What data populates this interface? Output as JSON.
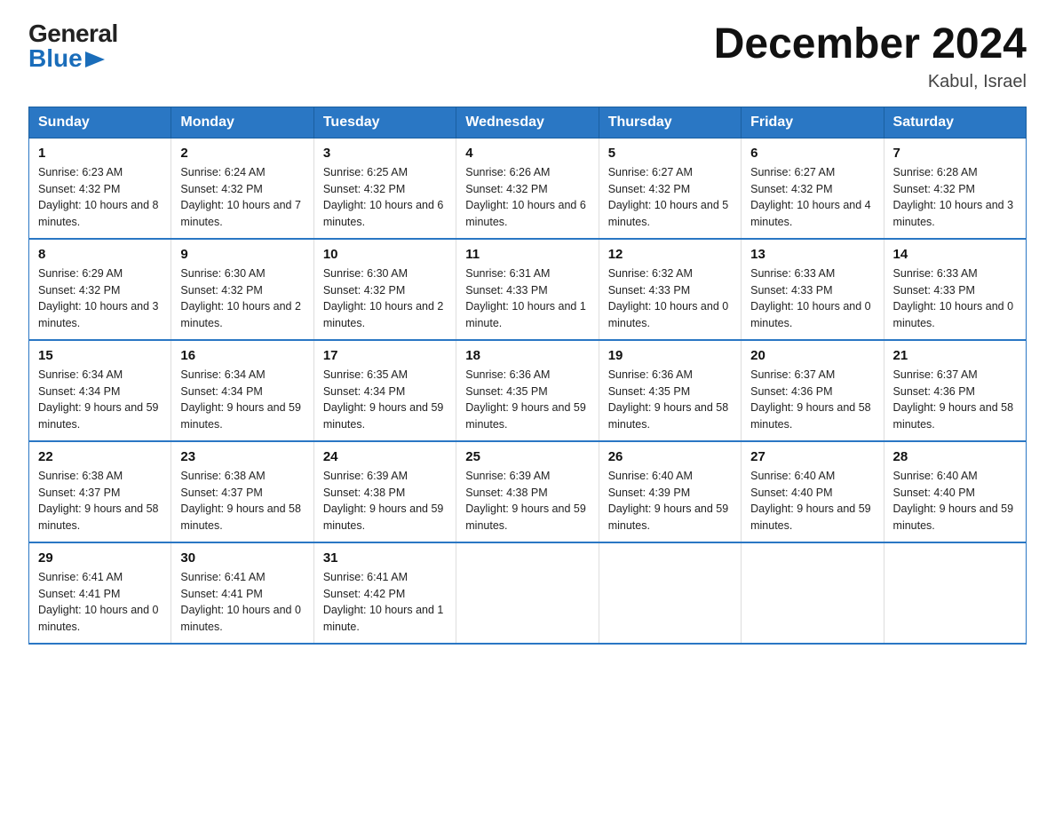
{
  "header": {
    "logo_general": "General",
    "logo_blue": "Blue",
    "title": "December 2024",
    "location": "Kabul, Israel"
  },
  "days_of_week": [
    "Sunday",
    "Monday",
    "Tuesday",
    "Wednesday",
    "Thursday",
    "Friday",
    "Saturday"
  ],
  "weeks": [
    [
      {
        "day": "1",
        "sunrise": "6:23 AM",
        "sunset": "4:32 PM",
        "daylight": "10 hours and 8 minutes."
      },
      {
        "day": "2",
        "sunrise": "6:24 AM",
        "sunset": "4:32 PM",
        "daylight": "10 hours and 7 minutes."
      },
      {
        "day": "3",
        "sunrise": "6:25 AM",
        "sunset": "4:32 PM",
        "daylight": "10 hours and 6 minutes."
      },
      {
        "day": "4",
        "sunrise": "6:26 AM",
        "sunset": "4:32 PM",
        "daylight": "10 hours and 6 minutes."
      },
      {
        "day": "5",
        "sunrise": "6:27 AM",
        "sunset": "4:32 PM",
        "daylight": "10 hours and 5 minutes."
      },
      {
        "day": "6",
        "sunrise": "6:27 AM",
        "sunset": "4:32 PM",
        "daylight": "10 hours and 4 minutes."
      },
      {
        "day": "7",
        "sunrise": "6:28 AM",
        "sunset": "4:32 PM",
        "daylight": "10 hours and 3 minutes."
      }
    ],
    [
      {
        "day": "8",
        "sunrise": "6:29 AM",
        "sunset": "4:32 PM",
        "daylight": "10 hours and 3 minutes."
      },
      {
        "day": "9",
        "sunrise": "6:30 AM",
        "sunset": "4:32 PM",
        "daylight": "10 hours and 2 minutes."
      },
      {
        "day": "10",
        "sunrise": "6:30 AM",
        "sunset": "4:32 PM",
        "daylight": "10 hours and 2 minutes."
      },
      {
        "day": "11",
        "sunrise": "6:31 AM",
        "sunset": "4:33 PM",
        "daylight": "10 hours and 1 minute."
      },
      {
        "day": "12",
        "sunrise": "6:32 AM",
        "sunset": "4:33 PM",
        "daylight": "10 hours and 0 minutes."
      },
      {
        "day": "13",
        "sunrise": "6:33 AM",
        "sunset": "4:33 PM",
        "daylight": "10 hours and 0 minutes."
      },
      {
        "day": "14",
        "sunrise": "6:33 AM",
        "sunset": "4:33 PM",
        "daylight": "10 hours and 0 minutes."
      }
    ],
    [
      {
        "day": "15",
        "sunrise": "6:34 AM",
        "sunset": "4:34 PM",
        "daylight": "9 hours and 59 minutes."
      },
      {
        "day": "16",
        "sunrise": "6:34 AM",
        "sunset": "4:34 PM",
        "daylight": "9 hours and 59 minutes."
      },
      {
        "day": "17",
        "sunrise": "6:35 AM",
        "sunset": "4:34 PM",
        "daylight": "9 hours and 59 minutes."
      },
      {
        "day": "18",
        "sunrise": "6:36 AM",
        "sunset": "4:35 PM",
        "daylight": "9 hours and 59 minutes."
      },
      {
        "day": "19",
        "sunrise": "6:36 AM",
        "sunset": "4:35 PM",
        "daylight": "9 hours and 58 minutes."
      },
      {
        "day": "20",
        "sunrise": "6:37 AM",
        "sunset": "4:36 PM",
        "daylight": "9 hours and 58 minutes."
      },
      {
        "day": "21",
        "sunrise": "6:37 AM",
        "sunset": "4:36 PM",
        "daylight": "9 hours and 58 minutes."
      }
    ],
    [
      {
        "day": "22",
        "sunrise": "6:38 AM",
        "sunset": "4:37 PM",
        "daylight": "9 hours and 58 minutes."
      },
      {
        "day": "23",
        "sunrise": "6:38 AM",
        "sunset": "4:37 PM",
        "daylight": "9 hours and 58 minutes."
      },
      {
        "day": "24",
        "sunrise": "6:39 AM",
        "sunset": "4:38 PM",
        "daylight": "9 hours and 59 minutes."
      },
      {
        "day": "25",
        "sunrise": "6:39 AM",
        "sunset": "4:38 PM",
        "daylight": "9 hours and 59 minutes."
      },
      {
        "day": "26",
        "sunrise": "6:40 AM",
        "sunset": "4:39 PM",
        "daylight": "9 hours and 59 minutes."
      },
      {
        "day": "27",
        "sunrise": "6:40 AM",
        "sunset": "4:40 PM",
        "daylight": "9 hours and 59 minutes."
      },
      {
        "day": "28",
        "sunrise": "6:40 AM",
        "sunset": "4:40 PM",
        "daylight": "9 hours and 59 minutes."
      }
    ],
    [
      {
        "day": "29",
        "sunrise": "6:41 AM",
        "sunset": "4:41 PM",
        "daylight": "10 hours and 0 minutes."
      },
      {
        "day": "30",
        "sunrise": "6:41 AM",
        "sunset": "4:41 PM",
        "daylight": "10 hours and 0 minutes."
      },
      {
        "day": "31",
        "sunrise": "6:41 AM",
        "sunset": "4:42 PM",
        "daylight": "10 hours and 1 minute."
      },
      null,
      null,
      null,
      null
    ]
  ],
  "labels": {
    "sunrise": "Sunrise:",
    "sunset": "Sunset:",
    "daylight": "Daylight:"
  }
}
